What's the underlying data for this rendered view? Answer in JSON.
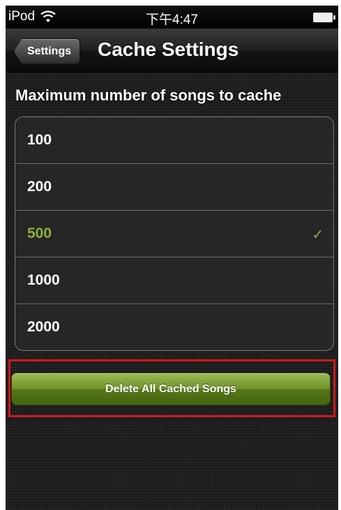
{
  "status_bar": {
    "carrier": "iPod",
    "time": "下午4:47",
    "wifi_icon": "wifi-icon",
    "battery_icon": "battery-icon"
  },
  "nav_bar": {
    "back_label": "Settings",
    "title": "Cache Settings"
  },
  "section": {
    "header": "Maximum number of songs to cache",
    "options": [
      {
        "label": "100",
        "selected": false
      },
      {
        "label": "200",
        "selected": false
      },
      {
        "label": "500",
        "selected": true
      },
      {
        "label": "1000",
        "selected": false
      },
      {
        "label": "2000",
        "selected": false
      }
    ],
    "checkmark": "✓"
  },
  "actions": {
    "delete_label": "Delete All Cached Songs"
  },
  "colors": {
    "accent": "#8fae3f",
    "highlight": "#d0191a"
  }
}
